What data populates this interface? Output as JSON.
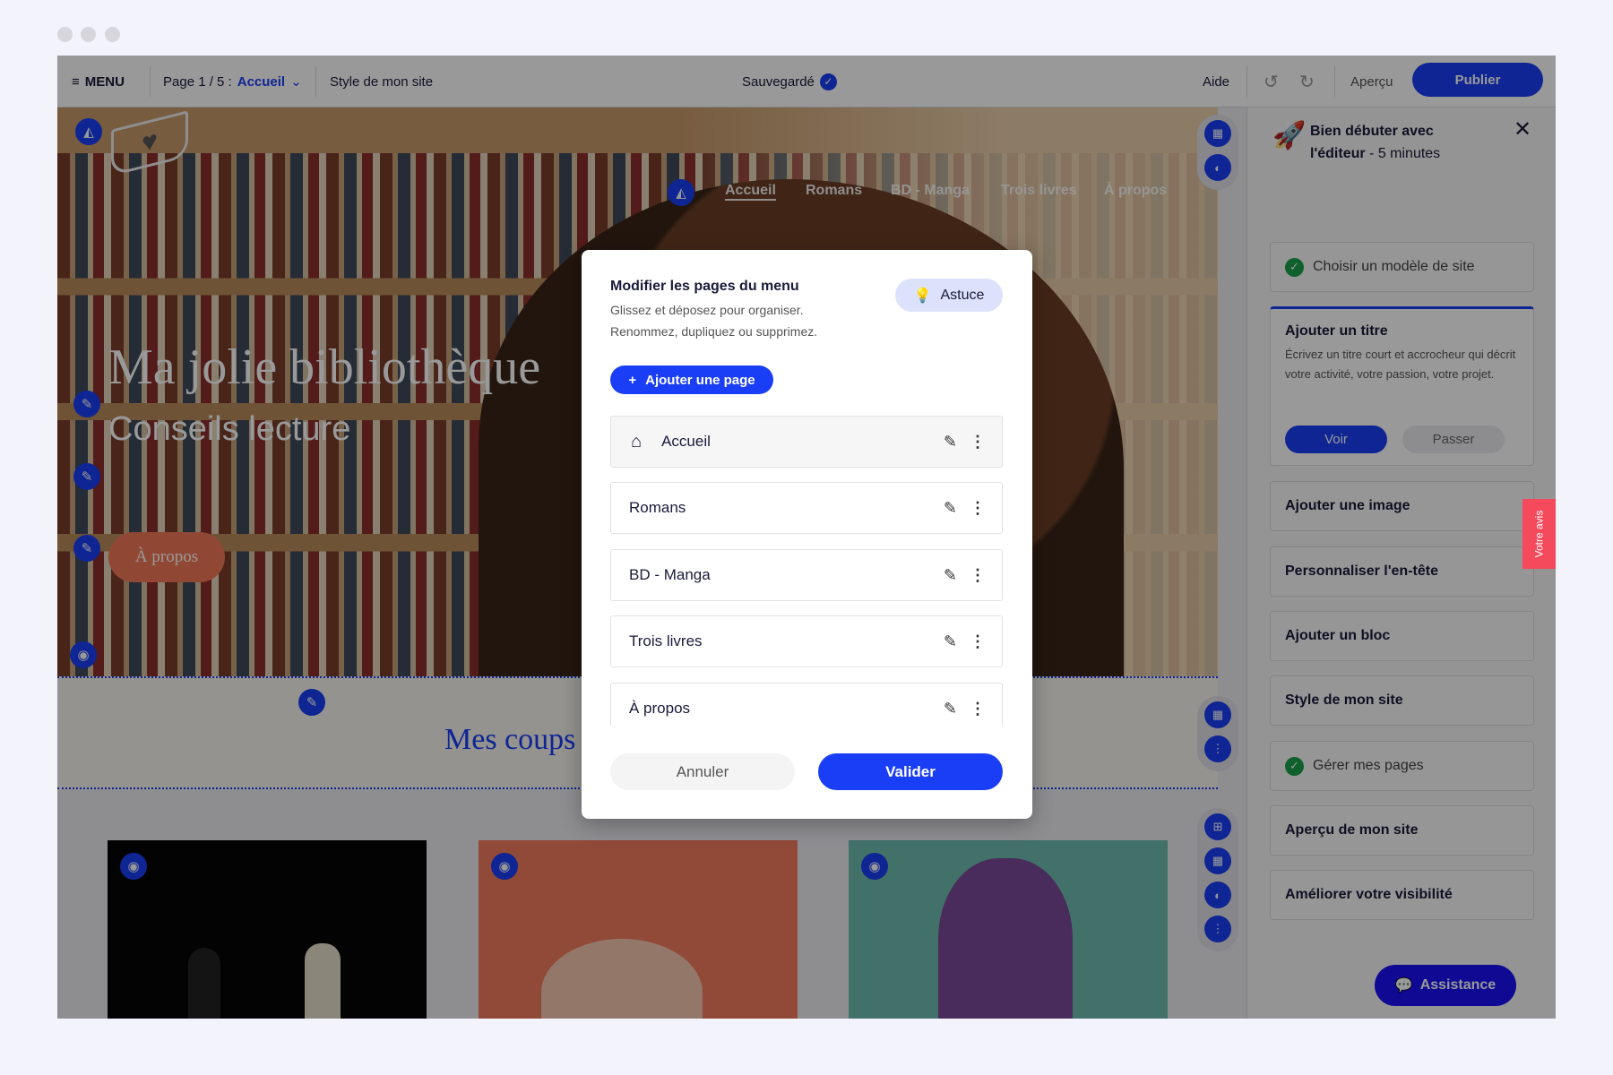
{
  "toolbar": {
    "menu": "MENU",
    "page_prefix": "Page 1 / 5 : ",
    "page_current": "Accueil",
    "style": "Style de mon site",
    "saved": "Sauvegardé",
    "help": "Aide",
    "preview": "Aperçu",
    "publish": "Publier"
  },
  "site": {
    "nav": [
      "Accueil",
      "Romans",
      "BD - Manga",
      "Trois livres",
      "À propos"
    ],
    "title": "Ma jolie bibliothèque",
    "subtitle": "Conseils lecture",
    "button": "À propos",
    "section_title": "Mes coups"
  },
  "modal": {
    "title": "Modifier les pages du menu",
    "line1": "Glissez et déposez pour organiser.",
    "line2": "Renommez, dupliquez ou supprimez.",
    "tip": "Astuce",
    "add": "Ajouter une page",
    "pages": [
      "Accueil",
      "Romans",
      "BD - Manga",
      "Trois livres",
      "À propos"
    ],
    "cancel": "Annuler",
    "confirm": "Valider"
  },
  "sidebar": {
    "title_bold": "Bien débuter avec l'éditeur",
    "title_rest": " - 5 minutes",
    "done1": "Choisir un modèle de site",
    "active": {
      "title": "Ajouter un titre",
      "desc": "Écrivez un titre court et accrocheur qui décrit votre activité, votre passion, votre projet.",
      "see": "Voir",
      "skip": "Passer"
    },
    "items": [
      "Ajouter une image",
      "Personnaliser l'en-tête",
      "Ajouter un bloc",
      "Style de mon site",
      "Gérer mes pages",
      "Aperçu de mon site",
      "Améliorer votre visibilité"
    ],
    "assist": "Assistance"
  },
  "feedback": "Votre avis",
  "colors": {
    "accent": "#1a3ef5",
    "success": "#1aa04a",
    "feedback": "#f44a5c",
    "hero_button": "#f07858"
  }
}
